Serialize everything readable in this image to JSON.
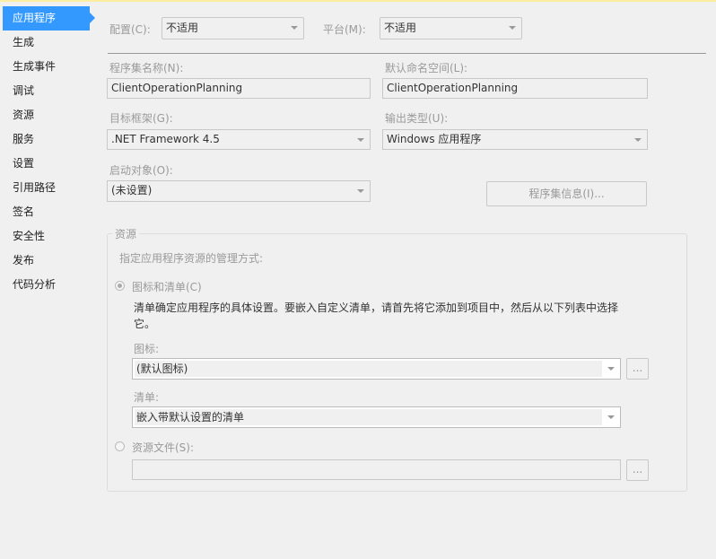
{
  "sidebar": {
    "items": [
      "应用程序",
      "生成",
      "生成事件",
      "调试",
      "资源",
      "服务",
      "设置",
      "引用路径",
      "签名",
      "安全性",
      "发布",
      "代码分析"
    ]
  },
  "config": {
    "label": "配置(C):",
    "value": "不适用"
  },
  "platform": {
    "label": "平台(M):",
    "value": "不适用"
  },
  "assembly_name": {
    "label": "程序集名称(N):",
    "value": "ClientOperationPlanning"
  },
  "default_namespace": {
    "label": "默认命名空间(L):",
    "value": "ClientOperationPlanning"
  },
  "target_framework": {
    "label": "目标框架(G):",
    "value": ".NET Framework 4.5"
  },
  "output_type": {
    "label": "输出类型(U):",
    "value": "Windows 应用程序"
  },
  "startup_object": {
    "label": "启动对象(O):",
    "value": "(未设置)"
  },
  "assembly_info_button": "程序集信息(I)...",
  "resources": {
    "title": "资源",
    "description": "指定应用程序资源的管理方式:",
    "icon_manifest_radio": "图标和清单(C)",
    "manifest_help_line1": "清单确定应用程序的具体设置。要嵌入自定义清单，请首先将它添加到项目中，然后从以下列表中选择",
    "manifest_help_line2": "它。",
    "icon_label": "图标:",
    "icon_value": "(默认图标)",
    "manifest_label": "清单:",
    "manifest_value": "嵌入带默认设置的清单",
    "resource_file_radio": "资源文件(S):",
    "resource_file_value": "",
    "browse_label": "..."
  }
}
